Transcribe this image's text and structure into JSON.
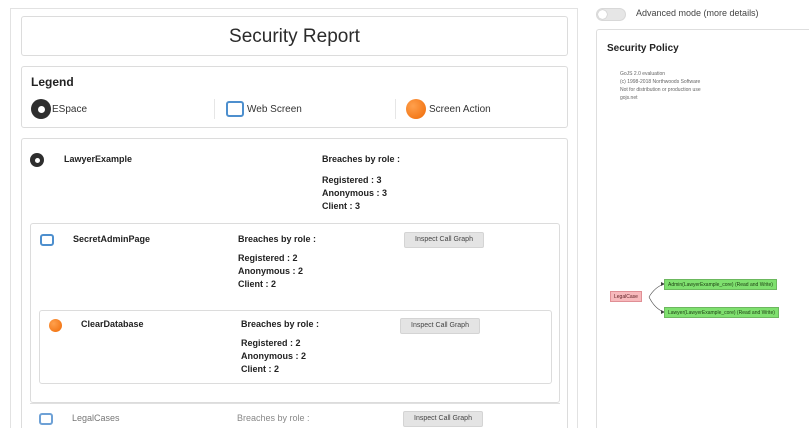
{
  "report": {
    "title": "Security Report",
    "legend": {
      "title": "Legend",
      "items": [
        {
          "icon": "espace-icon",
          "label": "ESpace"
        },
        {
          "icon": "web-screen-icon",
          "label": "Web Screen"
        },
        {
          "icon": "screen-action-icon",
          "label": "Screen Action"
        }
      ]
    },
    "espace": {
      "name": "LawyerExample",
      "breaches_label": "Breaches by role :",
      "roles": [
        "Registered : 3",
        "Anonymous : 3",
        "Client : 3"
      ],
      "screens": [
        {
          "name": "SecretAdminPage",
          "breaches_label": "Breaches by role :",
          "roles": [
            "Registered : 2",
            "Anonymous : 2",
            "Client : 2"
          ],
          "button": "Inspect Call Graph",
          "action": {
            "name": "ClearDatabase",
            "breaches_label": "Breaches by role :",
            "roles": [
              "Registered : 2",
              "Anonymous : 2",
              "Client : 2"
            ],
            "button": "Inspect Call Graph"
          }
        },
        {
          "name": "LegalCases",
          "breaches_label": "Breaches by role :",
          "button": "Inspect Call Graph"
        }
      ]
    }
  },
  "side": {
    "toggle_label": "Advanced mode (more details)",
    "toggle_on": false,
    "panel_title": "Security Policy",
    "gojs_notice": [
      "GoJS 2.0 evaluation",
      "(c) 1998-2018 Northwoods Software",
      "Not for distribution or production use",
      "gojs.net"
    ],
    "graph": {
      "root": "LegalCase",
      "children": [
        "Admin(LawyerExample_core) (Read and Write)",
        "Lawyer(LawyerExample_core) (Read and Write)"
      ]
    }
  },
  "colors": {
    "accent_blue": "#4d8fce",
    "action_orange": "#ef6a06",
    "node_green": "#7fe06f",
    "node_pink": "#f7b9bc"
  }
}
